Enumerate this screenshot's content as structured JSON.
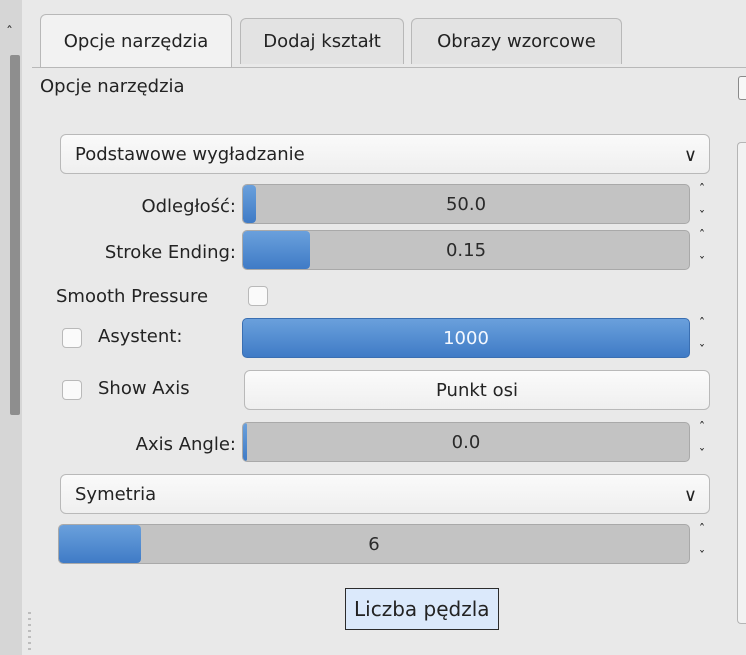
{
  "tabs": [
    {
      "label": "Opcje narzędzia"
    },
    {
      "label": "Dodaj kształt"
    },
    {
      "label": "Obrazy wzorcowe"
    }
  ],
  "panel_title": "Opcje narzędzia",
  "smoothing": {
    "selected": "Podstawowe wygładzanie"
  },
  "distance": {
    "label": "Odległość:",
    "value": "50.0",
    "fill_fraction": 0.03
  },
  "stroke_ending": {
    "label": "Stroke Ending:",
    "value": "0.15",
    "fill_fraction": 0.15
  },
  "smooth_pressure": {
    "label": "Smooth Pressure",
    "checked": false
  },
  "assistant": {
    "label": "Asystent:",
    "checked": false,
    "value": "1000",
    "fill_fraction": 1.0
  },
  "show_axis": {
    "label": "Show Axis",
    "checked": false,
    "button_label": "Punkt osi"
  },
  "axis_angle": {
    "label": "Axis Angle:",
    "value": "0.0",
    "fill_fraction": 0.0
  },
  "mode": {
    "selected": "Symetria"
  },
  "brush_count": {
    "value": "6",
    "fill_fraction": 0.13
  },
  "tooltip": {
    "text": "Liczba pędzla"
  },
  "colors": {
    "accent": "#4a86cf",
    "slider_bg": "#c3c3c3",
    "tooltip_bg": "#dbe9fb"
  }
}
